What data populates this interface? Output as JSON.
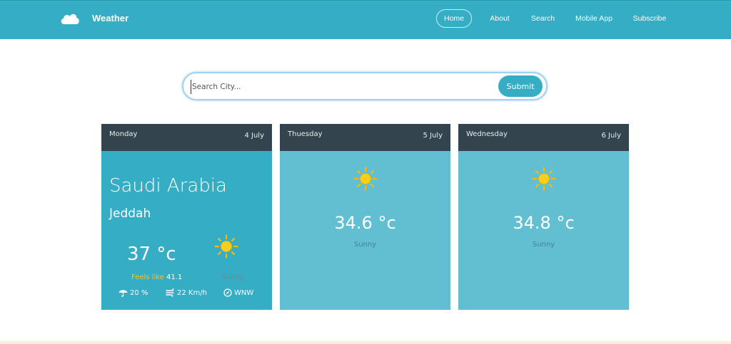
{
  "app": {
    "title": "Weather"
  },
  "nav": {
    "items": [
      "Home",
      "About",
      "Search",
      "Mobile App",
      "Subscribe"
    ],
    "active": "Home"
  },
  "search": {
    "placeholder": "Search City...",
    "value": "",
    "submit_label": "Submit"
  },
  "forecast": [
    {
      "day": "Monday",
      "date": "4 July",
      "country": "Saudi Arabia",
      "city": "Jeddah",
      "temp": "37",
      "unit": "°c",
      "icon": "sun-icon",
      "condition": "Sunny",
      "feels_like_label": "Feels like",
      "feels_like_value": "41.1",
      "humidity": "20 %",
      "wind_speed": "22 Km/h",
      "wind_direction": "WNW"
    },
    {
      "day": "Thuesday",
      "date": "5 July",
      "temp": "34.6",
      "unit": "°c",
      "icon": "sun-icon",
      "condition": "Sunny"
    },
    {
      "day": "Wednesday",
      "date": "6 July",
      "temp": "34.8",
      "unit": "°c",
      "icon": "sun-icon",
      "condition": "Sunny"
    }
  ],
  "colors": {
    "brand": "#35adc5",
    "card_header": "#33444e",
    "card_today": "#35adc5",
    "card_future": "#62bfd2",
    "feels_like": "#f5c518",
    "sun": "#f5b914"
  }
}
